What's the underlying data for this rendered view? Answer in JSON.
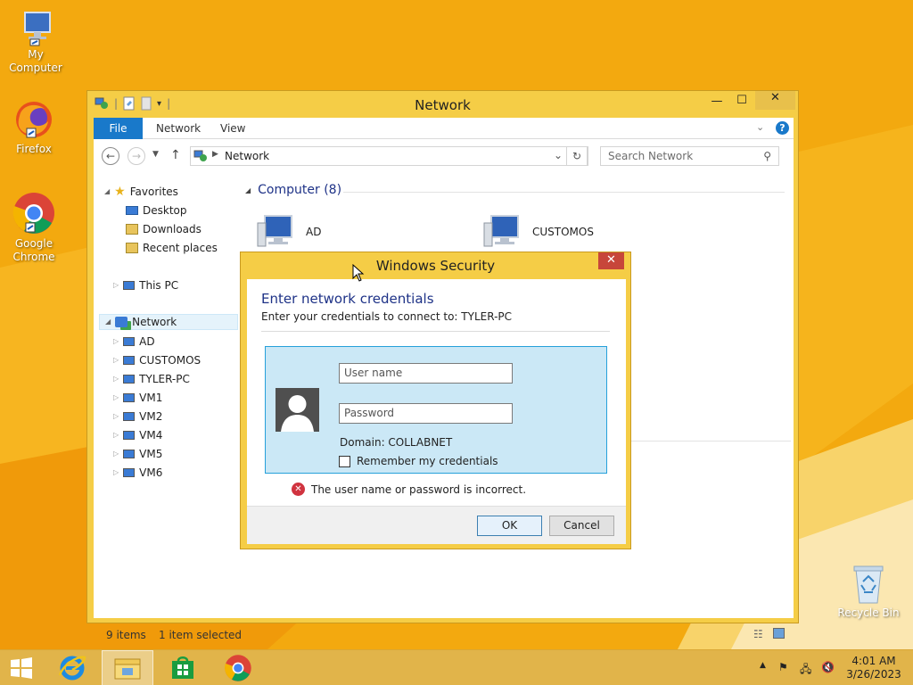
{
  "desktop": {
    "icons": [
      {
        "label": "My Computer"
      },
      {
        "label": "Firefox"
      },
      {
        "label": "Google Chrome"
      },
      {
        "label": "Recycle Bin"
      }
    ]
  },
  "explorer": {
    "title": "Network",
    "ribbon_tabs": {
      "file": "File",
      "network": "Network",
      "view": "View"
    },
    "address": {
      "path": "Network"
    },
    "search": {
      "placeholder": "Search Network"
    },
    "nav": {
      "favorites": "Favorites",
      "desktop": "Desktop",
      "downloads": "Downloads",
      "recent": "Recent places",
      "this_pc": "This PC",
      "network": "Network",
      "computers": [
        "AD",
        "CUSTOMOS",
        "TYLER-PC",
        "VM1",
        "VM2",
        "VM4",
        "VM5",
        "VM6"
      ]
    },
    "content": {
      "group_header": "Computer (8)",
      "items": [
        "AD",
        "CUSTOMOS"
      ]
    },
    "status": {
      "count": "9 items",
      "selection": "1 item selected"
    }
  },
  "dialog": {
    "title": "Windows Security",
    "heading": "Enter network credentials",
    "subtitle": "Enter your credentials to connect to: TYLER-PC",
    "username_placeholder": "User name",
    "password_placeholder": "Password",
    "domain": "Domain: COLLABNET",
    "remember": "Remember my credentials",
    "error": "The user name or password is incorrect.",
    "ok": "OK",
    "cancel": "Cancel"
  },
  "taskbar": {
    "time": "4:01 AM",
    "date": "3/26/2023"
  },
  "colors": {
    "desktop_bg": "#f2a80c",
    "window_frame": "#f5cd46",
    "ribbon_file": "#1979ca",
    "credential_tile": "#cbe8f6",
    "dialog_heading": "#1e3287",
    "error": "#d0333f"
  }
}
